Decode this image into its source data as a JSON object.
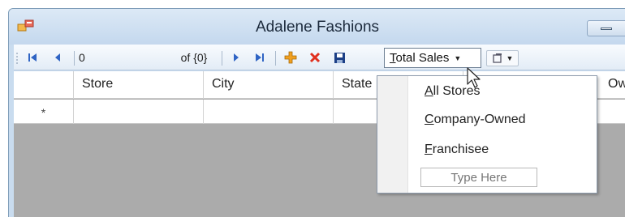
{
  "window": {
    "title": "Adalene Fashions"
  },
  "toolbar": {
    "position_value": "0",
    "count_text": "of {0}",
    "total_sales_label": "Total Sales"
  },
  "grid": {
    "columns": [
      "Store",
      "City",
      "State",
      "Ow"
    ],
    "new_row_marker": "*"
  },
  "dropdown": {
    "items": [
      "All Stores",
      "Company-Owned",
      "Franchisee"
    ],
    "type_here_placeholder": "Type Here"
  },
  "colors": {
    "move_first": "#2f64c4",
    "add_new": "#f0a020",
    "delete": "#e0301e",
    "save": "#1c3f86"
  },
  "icons": [
    "app-icon",
    "move-first-icon",
    "move-previous-icon",
    "move-next-icon",
    "move-last-icon",
    "add-new-icon",
    "delete-icon",
    "save-icon",
    "add-item-icon",
    "mouse-cursor-icon"
  ]
}
